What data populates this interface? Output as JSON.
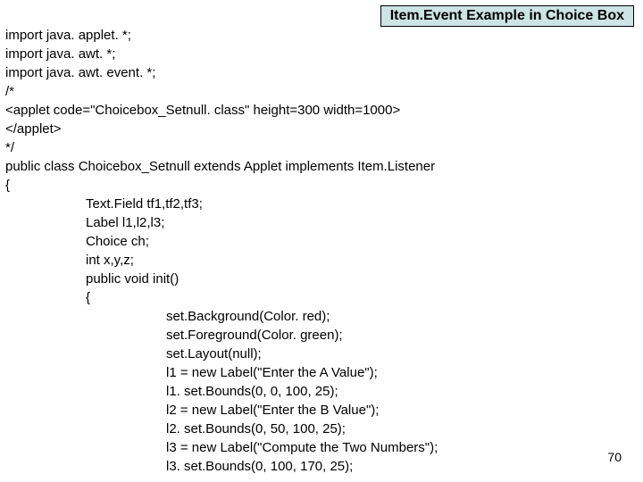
{
  "title": "Item.Event Example in Choice Box",
  "code": {
    "l1": "import java. applet. *;",
    "l2": "import java. awt. *;",
    "l3": "import java. awt. event. *;",
    "l4": "/*",
    "l5": "<applet code=\"Choicebox_Setnull. class\" height=300 width=1000>",
    "l6": "</applet>",
    "l7": "*/",
    "l8": "public class Choicebox_Setnull extends Applet implements Item.Listener",
    "l9": "{",
    "l10": "Text.Field tf1,tf2,tf3;",
    "l11": "Label l1,l2,l3;",
    "l12": "Choice ch;",
    "l13": "int x,y,z;",
    "l14": "public void init()",
    "l15": "{",
    "l16": "set.Background(Color. red);",
    "l17": "set.Foreground(Color. green);",
    "l18": "set.Layout(null);",
    "l19": "l1 = new Label(\"Enter the A Value\");",
    "l20": "l1. set.Bounds(0, 0, 100, 25);",
    "l21": "l2 = new Label(\"Enter the B Value\");",
    "l22": "l2. set.Bounds(0, 50, 100, 25);",
    "l23": "l3 = new Label(\"Compute the Two Numbers\");",
    "l24": "l3. set.Bounds(0, 100, 170, 25);"
  },
  "page_number": "70"
}
